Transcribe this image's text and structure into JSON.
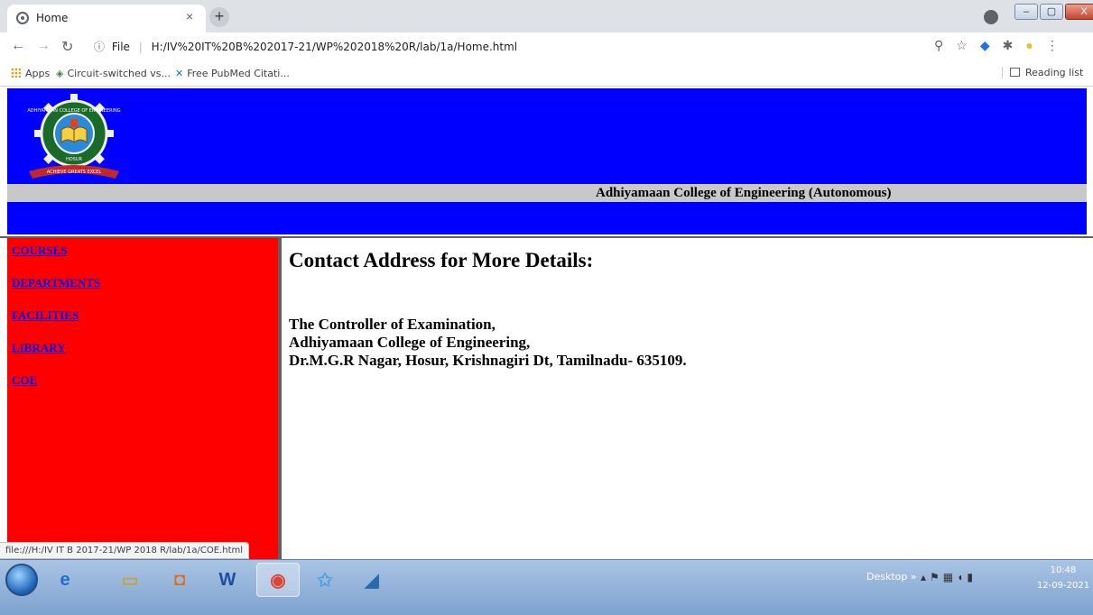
{
  "browser": {
    "tab_title": "Home",
    "tab_close": "×",
    "new_tab": "+",
    "window_controls": [
      "–",
      "▢",
      "X"
    ],
    "omnibox_info": "ⓘ",
    "omnibox_scheme": "File",
    "omnibox_separator": "|",
    "omnibox_url": "H:/IV%20IT%20B%202017-21/WP%202018%20R/lab/1a/Home.html",
    "bookmarks": [
      "Apps",
      "Circuit-switched vs...",
      "Free PubMed Citati..."
    ],
    "reading_list": "Reading list",
    "status_url": "file:///H:/IV IT B 2017-21/WP 2018 R/lab/1a/COE.html"
  },
  "header": {
    "logo_ring_text": "ADHIYAMAAN COLLEGE OF ENGINEERING",
    "logo_city": "HOSUR",
    "logo_motto": "ACHIEVE GREATS EXCEL",
    "college_name": "Adhiyamaan College of Engineering (Autonomous)"
  },
  "sidebar": {
    "links": [
      "COURSES",
      "DEPARTMENTS",
      "FACILITIES",
      "LIBRARY",
      "COE"
    ]
  },
  "main": {
    "heading": "Contact Address for More Details:",
    "address": [
      "The Controller of Examination,",
      "Adhiyamaan College of Engineering,",
      "Dr.M.G.R Nagar, Hosur, Krishnagiri Dt, Tamilnadu- 635109."
    ]
  },
  "taskbar": {
    "word_label": "W",
    "desktop_label": "Desktop",
    "clock_time": "10:48",
    "clock_date": "12-09-2021"
  },
  "colors": {
    "header_bg": "#0000ff",
    "sidebar_bg": "#ff0000",
    "name_bar": "#c8c8c8",
    "link": "#0000ee"
  }
}
